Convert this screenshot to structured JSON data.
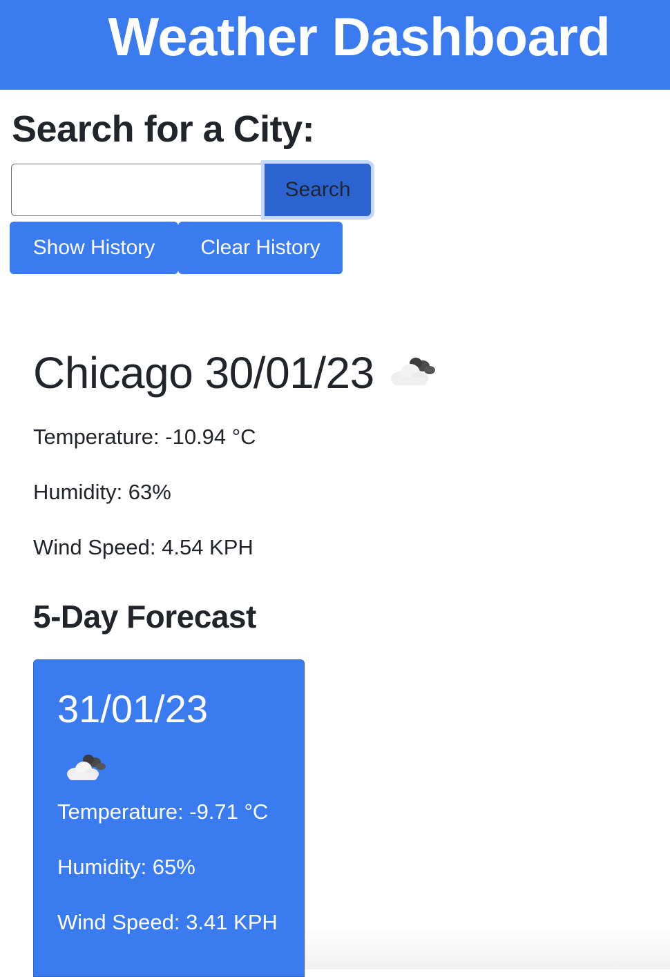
{
  "header": {
    "title": "Weather Dashboard"
  },
  "search": {
    "title": "Search for a City:",
    "input_value": "",
    "placeholder": "",
    "button_label": "Search"
  },
  "history": {
    "show_label": "Show History",
    "clear_label": "Clear History"
  },
  "current": {
    "heading": "Chicago 30/01/23",
    "icon": "cloudy-icon",
    "temperature": "Temperature: -10.94 °C",
    "humidity": "Humidity: 63%",
    "wind": "Wind Speed: 4.54 KPH"
  },
  "forecast": {
    "title": "5-Day Forecast",
    "cards": [
      {
        "date": "31/01/23",
        "icon": "cloudy-icon",
        "temperature": "Temperature: -9.71 °C",
        "humidity": "Humidity: 65%",
        "wind": "Wind Speed: 3.41 KPH"
      }
    ]
  },
  "colors": {
    "primary": "#3a7bf0",
    "search_button": "#2b63d0",
    "text": "#212529"
  }
}
